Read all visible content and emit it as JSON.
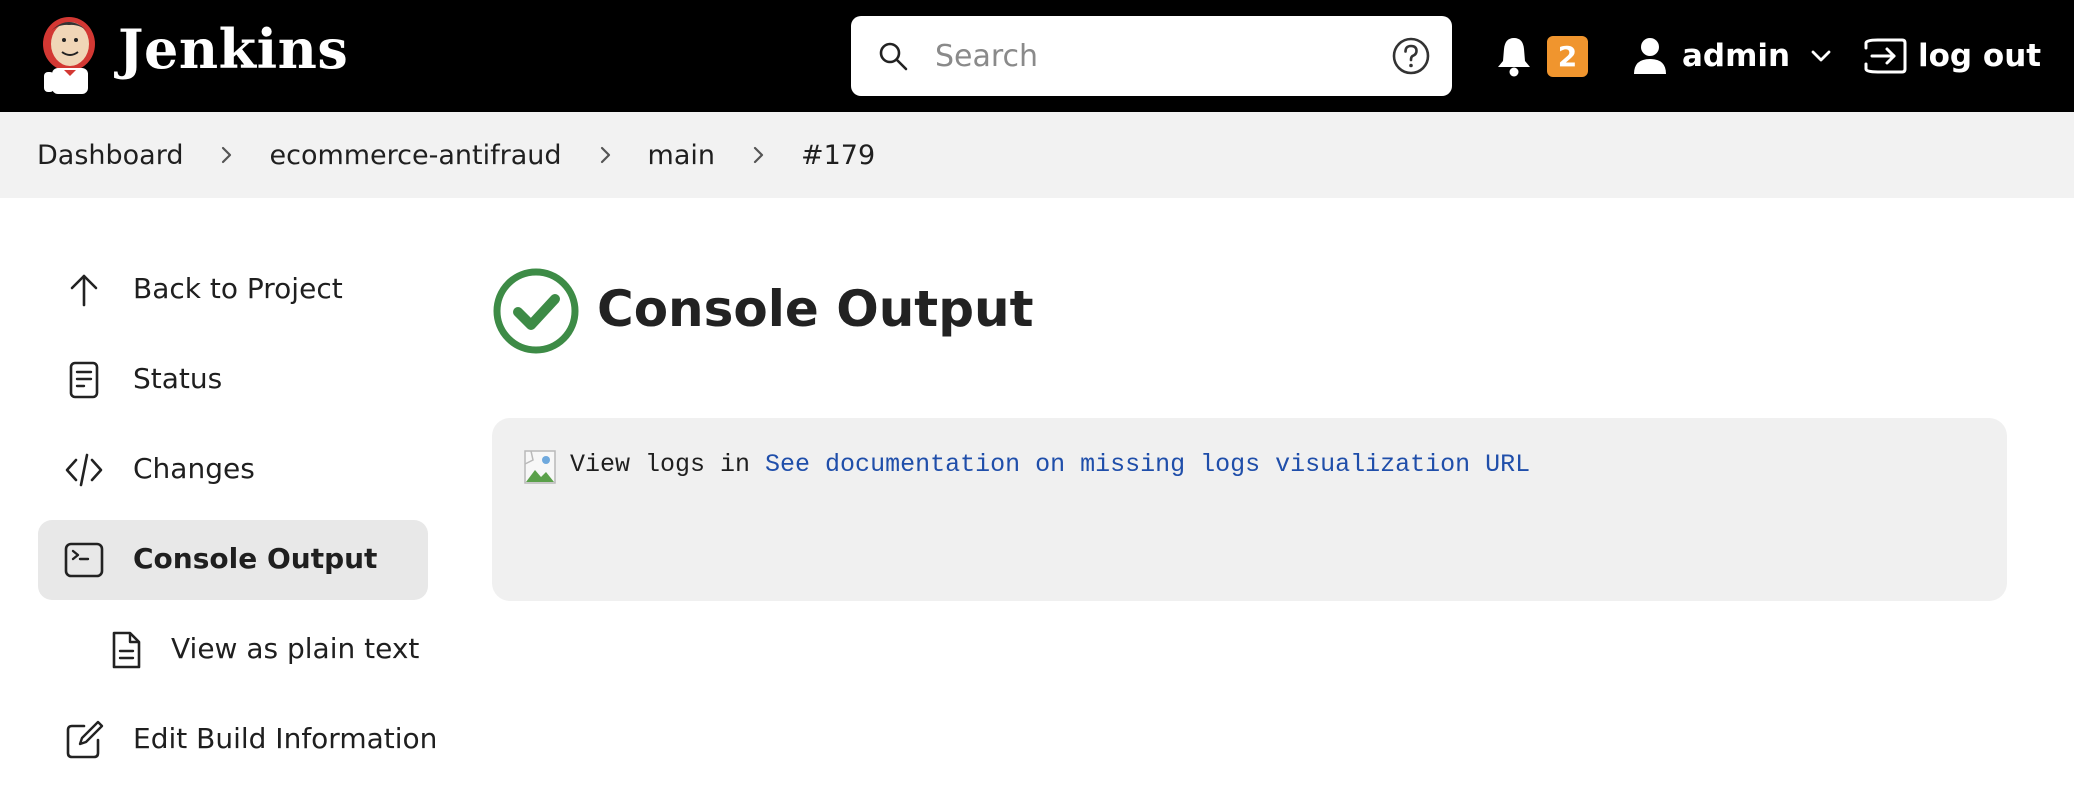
{
  "header": {
    "brand": "Jenkins",
    "search_placeholder": "Search",
    "notification_count": "2",
    "user_name": "admin",
    "logout_label": "log out",
    "badge_color": "#f0952e"
  },
  "breadcrumb": [
    "Dashboard",
    "ecommerce-antifraud",
    "main",
    "#179"
  ],
  "sidebar": {
    "items": [
      {
        "label": "Back to Project",
        "icon": "arrow-up-icon"
      },
      {
        "label": "Status",
        "icon": "document-icon"
      },
      {
        "label": "Changes",
        "icon": "code-icon"
      },
      {
        "label": "Console Output",
        "icon": "terminal-icon",
        "active": true
      },
      {
        "label": "View as plain text",
        "icon": "file-text-icon"
      },
      {
        "label": "Edit Build Information",
        "icon": "edit-icon"
      }
    ]
  },
  "main": {
    "title": "Console Output",
    "status_color": "#3d8b46",
    "console_prefix": "View logs in",
    "console_link": "See documentation on missing logs visualization URL"
  }
}
